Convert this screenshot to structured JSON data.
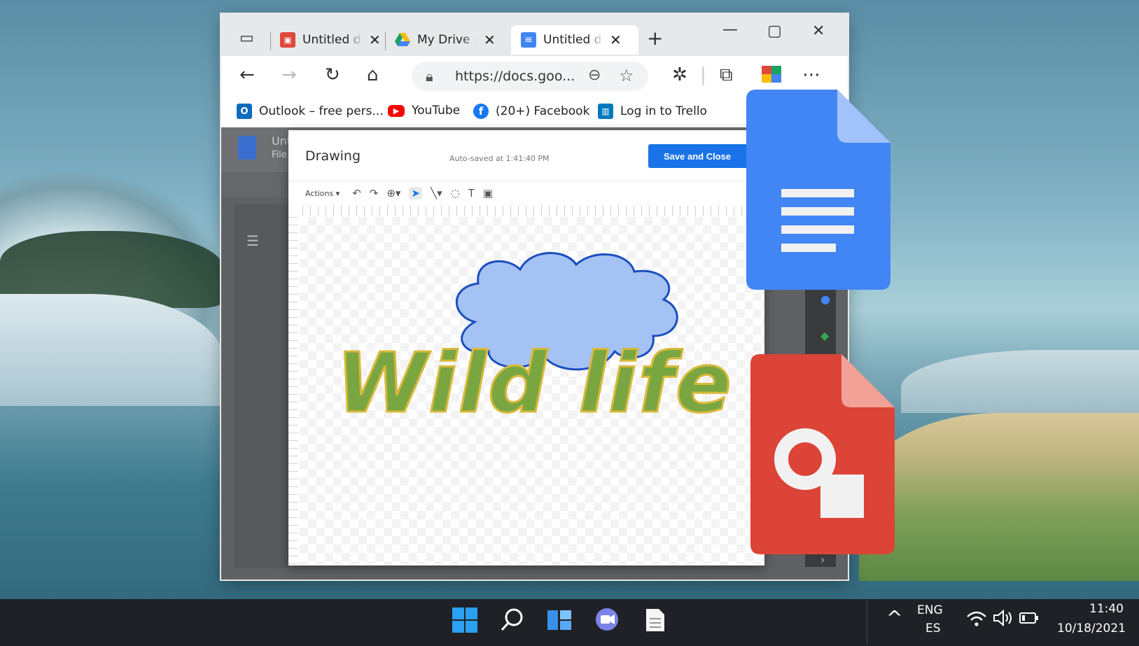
{
  "browser": {
    "tabs": [
      {
        "label": "Untitled drawing",
        "icon": "google-drawings-icon",
        "color": "#e0473c"
      },
      {
        "label": "My Drive - Google Drive",
        "icon": "google-drive-icon",
        "color": "#1aa260"
      },
      {
        "label": "Untitled document",
        "icon": "google-docs-icon",
        "color": "#4285f4",
        "active": true
      }
    ],
    "new_tab": "+",
    "url": "https://docs.goo...",
    "bookmarks": [
      {
        "label": "Outlook – free pers...",
        "icon": "outlook-icon",
        "color": "#0f6cbd"
      },
      {
        "label": "YouTube",
        "icon": "youtube-icon",
        "color": "#ff0000"
      },
      {
        "label": "(20+) Facebook",
        "icon": "facebook-icon",
        "color": "#1877f2"
      },
      {
        "label": "Log in to Trello",
        "icon": "trello-icon",
        "color": "#0079bf"
      }
    ]
  },
  "docs": {
    "title": "Unt",
    "menu_file": "File"
  },
  "drawing": {
    "title": "Drawing",
    "autosave": "Auto-saved at 1:41:40 PM",
    "save_close": "Save and Close",
    "actions": "Actions ▾",
    "canvas_text": "Wild life",
    "cloud_fill": "#a4c2f4",
    "cloud_stroke": "#1c4fbf"
  },
  "taskbar": {
    "lang_top": "ENG",
    "lang_bottom": "ES",
    "time": "11:40",
    "date": "10/18/2021"
  }
}
